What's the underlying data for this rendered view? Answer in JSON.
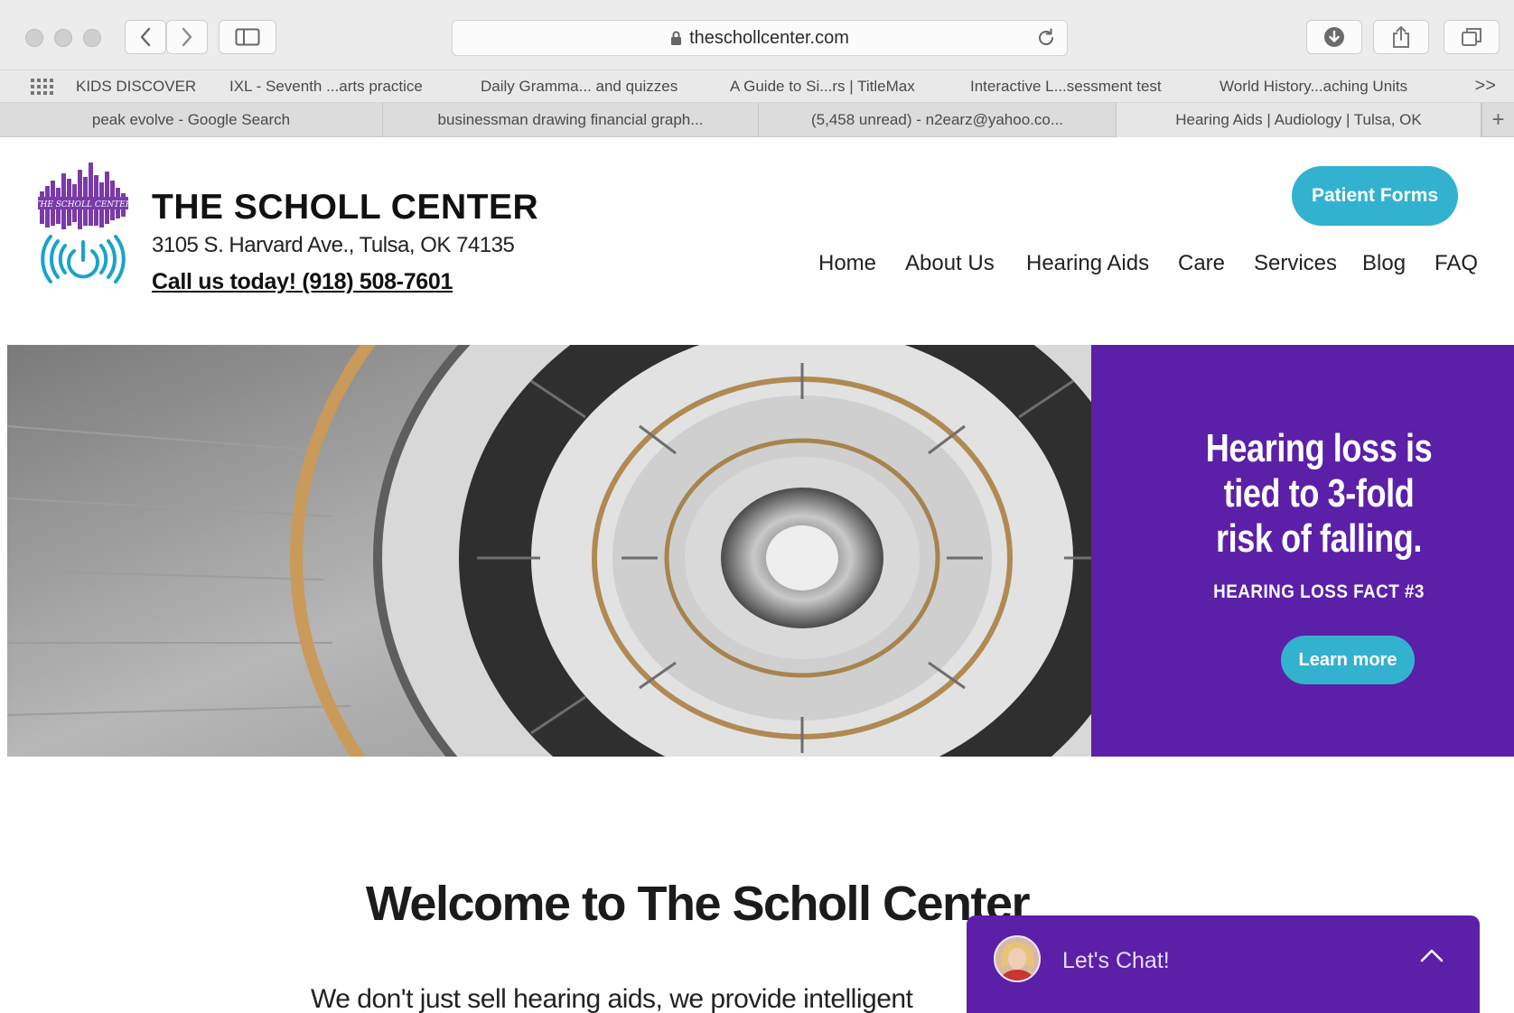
{
  "browser": {
    "url": "theschollcenter.com",
    "bookmarks": [
      "KIDS DISCOVER",
      "IXL - Seventh ...arts practice",
      "Daily Gramma... and quizzes",
      "A Guide to Si...rs | TitleMax",
      "Interactive L...sessment test",
      "World History...aching Units"
    ],
    "bookmarks_more": ">>",
    "tabs": [
      "peak evolve - Google Search",
      "businessman drawing financial graph...",
      "(5,458 unread) - n2earz@yahoo.co...",
      "Hearing Aids | Audiology | Tulsa, OK"
    ],
    "new_tab": "+"
  },
  "site": {
    "logo_text": "THE SCHOLL CENTER",
    "title": "THE SCHOLL CENTER",
    "address": "3105 S. Harvard Ave., Tulsa, OK 74135",
    "phone": "Call us today! (918) 508-7601",
    "patient_forms": "Patient Forms",
    "nav": [
      "Home",
      "About Us",
      "Hearing Aids",
      "Care",
      "Services",
      "Blog",
      "FAQ"
    ]
  },
  "hero": {
    "headline": "Hearing loss is tied to 3-fold risk of falling.",
    "subhead": "HEARING LOSS FACT #3",
    "cta": "Learn more"
  },
  "main": {
    "welcome": "Welcome to The Scholl Center",
    "intro": "We don't just sell hearing aids, we provide intelligent"
  },
  "chat": {
    "label": "Let's Chat!"
  },
  "colors": {
    "accent_purple": "#5b1fa8",
    "accent_teal": "#33b2d0"
  }
}
